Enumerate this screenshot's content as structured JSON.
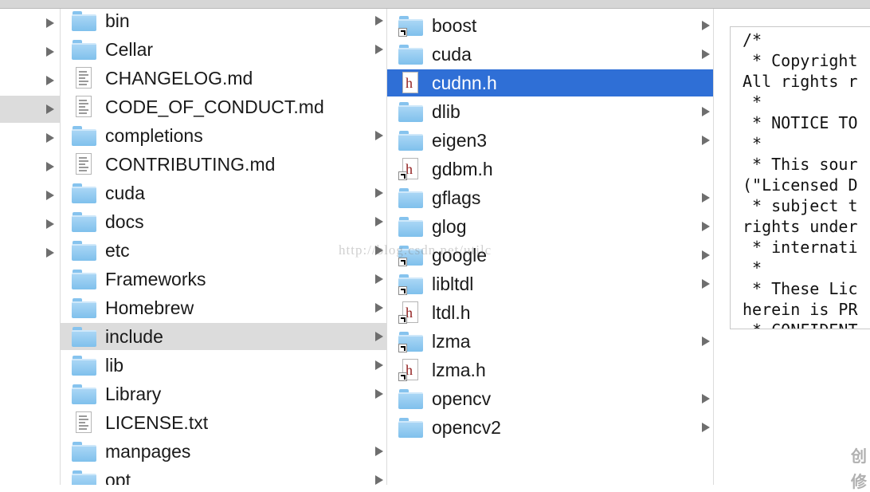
{
  "column1": {
    "selected": "include",
    "items": [
      {
        "name": "bin",
        "kind": "folder",
        "alias": false,
        "has_children": true
      },
      {
        "name": "Cellar",
        "kind": "folder",
        "alias": false,
        "has_children": true
      },
      {
        "name": "CHANGELOG.md",
        "kind": "doc",
        "alias": false,
        "has_children": false
      },
      {
        "name": "CODE_OF_CONDUCT.md",
        "kind": "doc",
        "alias": false,
        "has_children": false
      },
      {
        "name": "completions",
        "kind": "folder",
        "alias": false,
        "has_children": true
      },
      {
        "name": "CONTRIBUTING.md",
        "kind": "doc",
        "alias": false,
        "has_children": false
      },
      {
        "name": "cuda",
        "kind": "folder",
        "alias": false,
        "has_children": true
      },
      {
        "name": "docs",
        "kind": "folder",
        "alias": false,
        "has_children": true
      },
      {
        "name": "etc",
        "kind": "folder",
        "alias": false,
        "has_children": true
      },
      {
        "name": "Frameworks",
        "kind": "folder",
        "alias": false,
        "has_children": true
      },
      {
        "name": "Homebrew",
        "kind": "folder",
        "alias": false,
        "has_children": true
      },
      {
        "name": "include",
        "kind": "folder",
        "alias": false,
        "has_children": true
      },
      {
        "name": "lib",
        "kind": "folder",
        "alias": false,
        "has_children": true
      },
      {
        "name": "Library",
        "kind": "folder",
        "alias": false,
        "has_children": true
      },
      {
        "name": "LICENSE.txt",
        "kind": "txt",
        "alias": false,
        "has_children": false
      },
      {
        "name": "manpages",
        "kind": "folder",
        "alias": false,
        "has_children": true
      },
      {
        "name": "opt",
        "kind": "folder",
        "alias": false,
        "has_children": true
      }
    ]
  },
  "column2": {
    "selected": "cudnn.h",
    "items": [
      {
        "name": "boost",
        "kind": "folder",
        "alias": true,
        "has_children": true
      },
      {
        "name": "cuda",
        "kind": "folder",
        "alias": false,
        "has_children": true
      },
      {
        "name": "cudnn.h",
        "kind": "hfile",
        "alias": false,
        "has_children": false
      },
      {
        "name": "dlib",
        "kind": "folder",
        "alias": false,
        "has_children": true
      },
      {
        "name": "eigen3",
        "kind": "folder",
        "alias": false,
        "has_children": true
      },
      {
        "name": "gdbm.h",
        "kind": "hfile",
        "alias": true,
        "has_children": false
      },
      {
        "name": "gflags",
        "kind": "folder",
        "alias": false,
        "has_children": true
      },
      {
        "name": "glog",
        "kind": "folder",
        "alias": false,
        "has_children": true
      },
      {
        "name": "google",
        "kind": "folder",
        "alias": true,
        "has_children": true
      },
      {
        "name": "libltdl",
        "kind": "folder",
        "alias": true,
        "has_children": true
      },
      {
        "name": "ltdl.h",
        "kind": "hfile",
        "alias": true,
        "has_children": false
      },
      {
        "name": "lzma",
        "kind": "folder",
        "alias": true,
        "has_children": true
      },
      {
        "name": "lzma.h",
        "kind": "hfile",
        "alias": true,
        "has_children": false
      },
      {
        "name": "opencv",
        "kind": "folder",
        "alias": false,
        "has_children": true
      },
      {
        "name": "opencv2",
        "kind": "folder",
        "alias": false,
        "has_children": true
      }
    ]
  },
  "preview": {
    "lines": [
      "/*",
      " * Copyright",
      "All rights r",
      " *",
      " * NOTICE TO",
      " *",
      " * This sour",
      "(\"Licensed D",
      " * subject t",
      "rights under",
      " * internati",
      " *",
      " * These Lic",
      "herein is PR",
      " * CONFIDENT"
    ]
  },
  "watermark": "http://blog.csdn.net/utilc",
  "corner_text": [
    "创",
    "修"
  ],
  "colors": {
    "selection_blue": "#2f6fd6",
    "selection_gray": "#dcdcdc",
    "folder_blue": "#7fc0ec",
    "header_icon_red": "#8f1b1b"
  }
}
